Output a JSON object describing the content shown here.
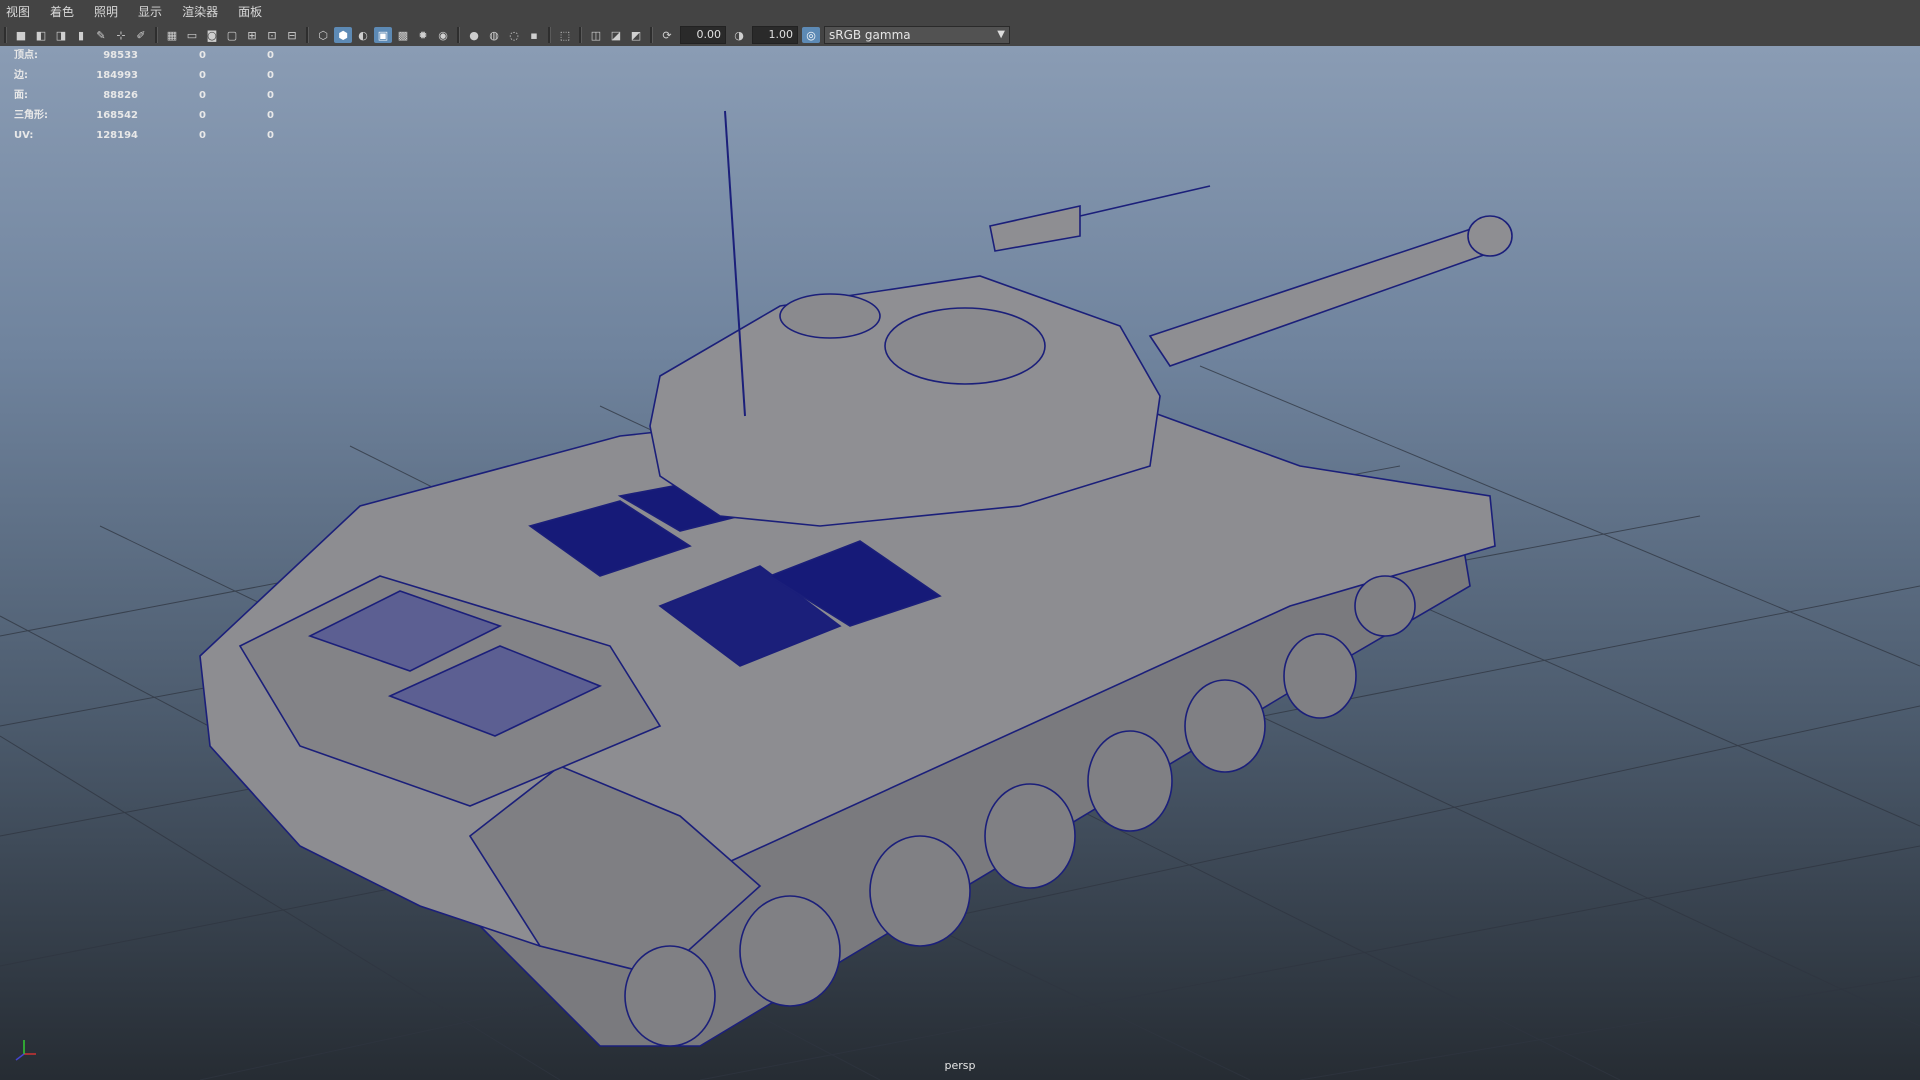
{
  "menu": [
    "视图",
    "着色",
    "照明",
    "显示",
    "渲染器",
    "面板"
  ],
  "toolbar": {
    "exposure": "0.00",
    "gamma": "1.00",
    "colorspace": "sRGB gamma"
  },
  "hud": {
    "rows": [
      {
        "label": "顶点:",
        "count": "98533",
        "sel": "0",
        "tri": "0"
      },
      {
        "label": "边:",
        "count": "184993",
        "sel": "0",
        "tri": "0"
      },
      {
        "label": "面:",
        "count": "88826",
        "sel": "0",
        "tri": "0"
      },
      {
        "label": "三角形:",
        "count": "168542",
        "sel": "0",
        "tri": "0"
      },
      {
        "label": "UV:",
        "count": "128194",
        "sel": "0",
        "tri": "0"
      }
    ]
  },
  "camera": "persp",
  "colors": {
    "wire": "#1b1f7a",
    "mesh": "#8b8b8f",
    "grid": "#2f3540",
    "accent": "#5d8ab5"
  },
  "icons": [
    "camera-icon",
    "bookmark-icon",
    "grid-icon",
    "film-gate-icon",
    "wireframe-icon",
    "smooth-shade-icon",
    "textured-icon",
    "lights-icon",
    "shadows-icon",
    "xray-icon",
    "isolate-icon",
    "exposure-icon",
    "gamma-icon",
    "colorspace-icon"
  ]
}
